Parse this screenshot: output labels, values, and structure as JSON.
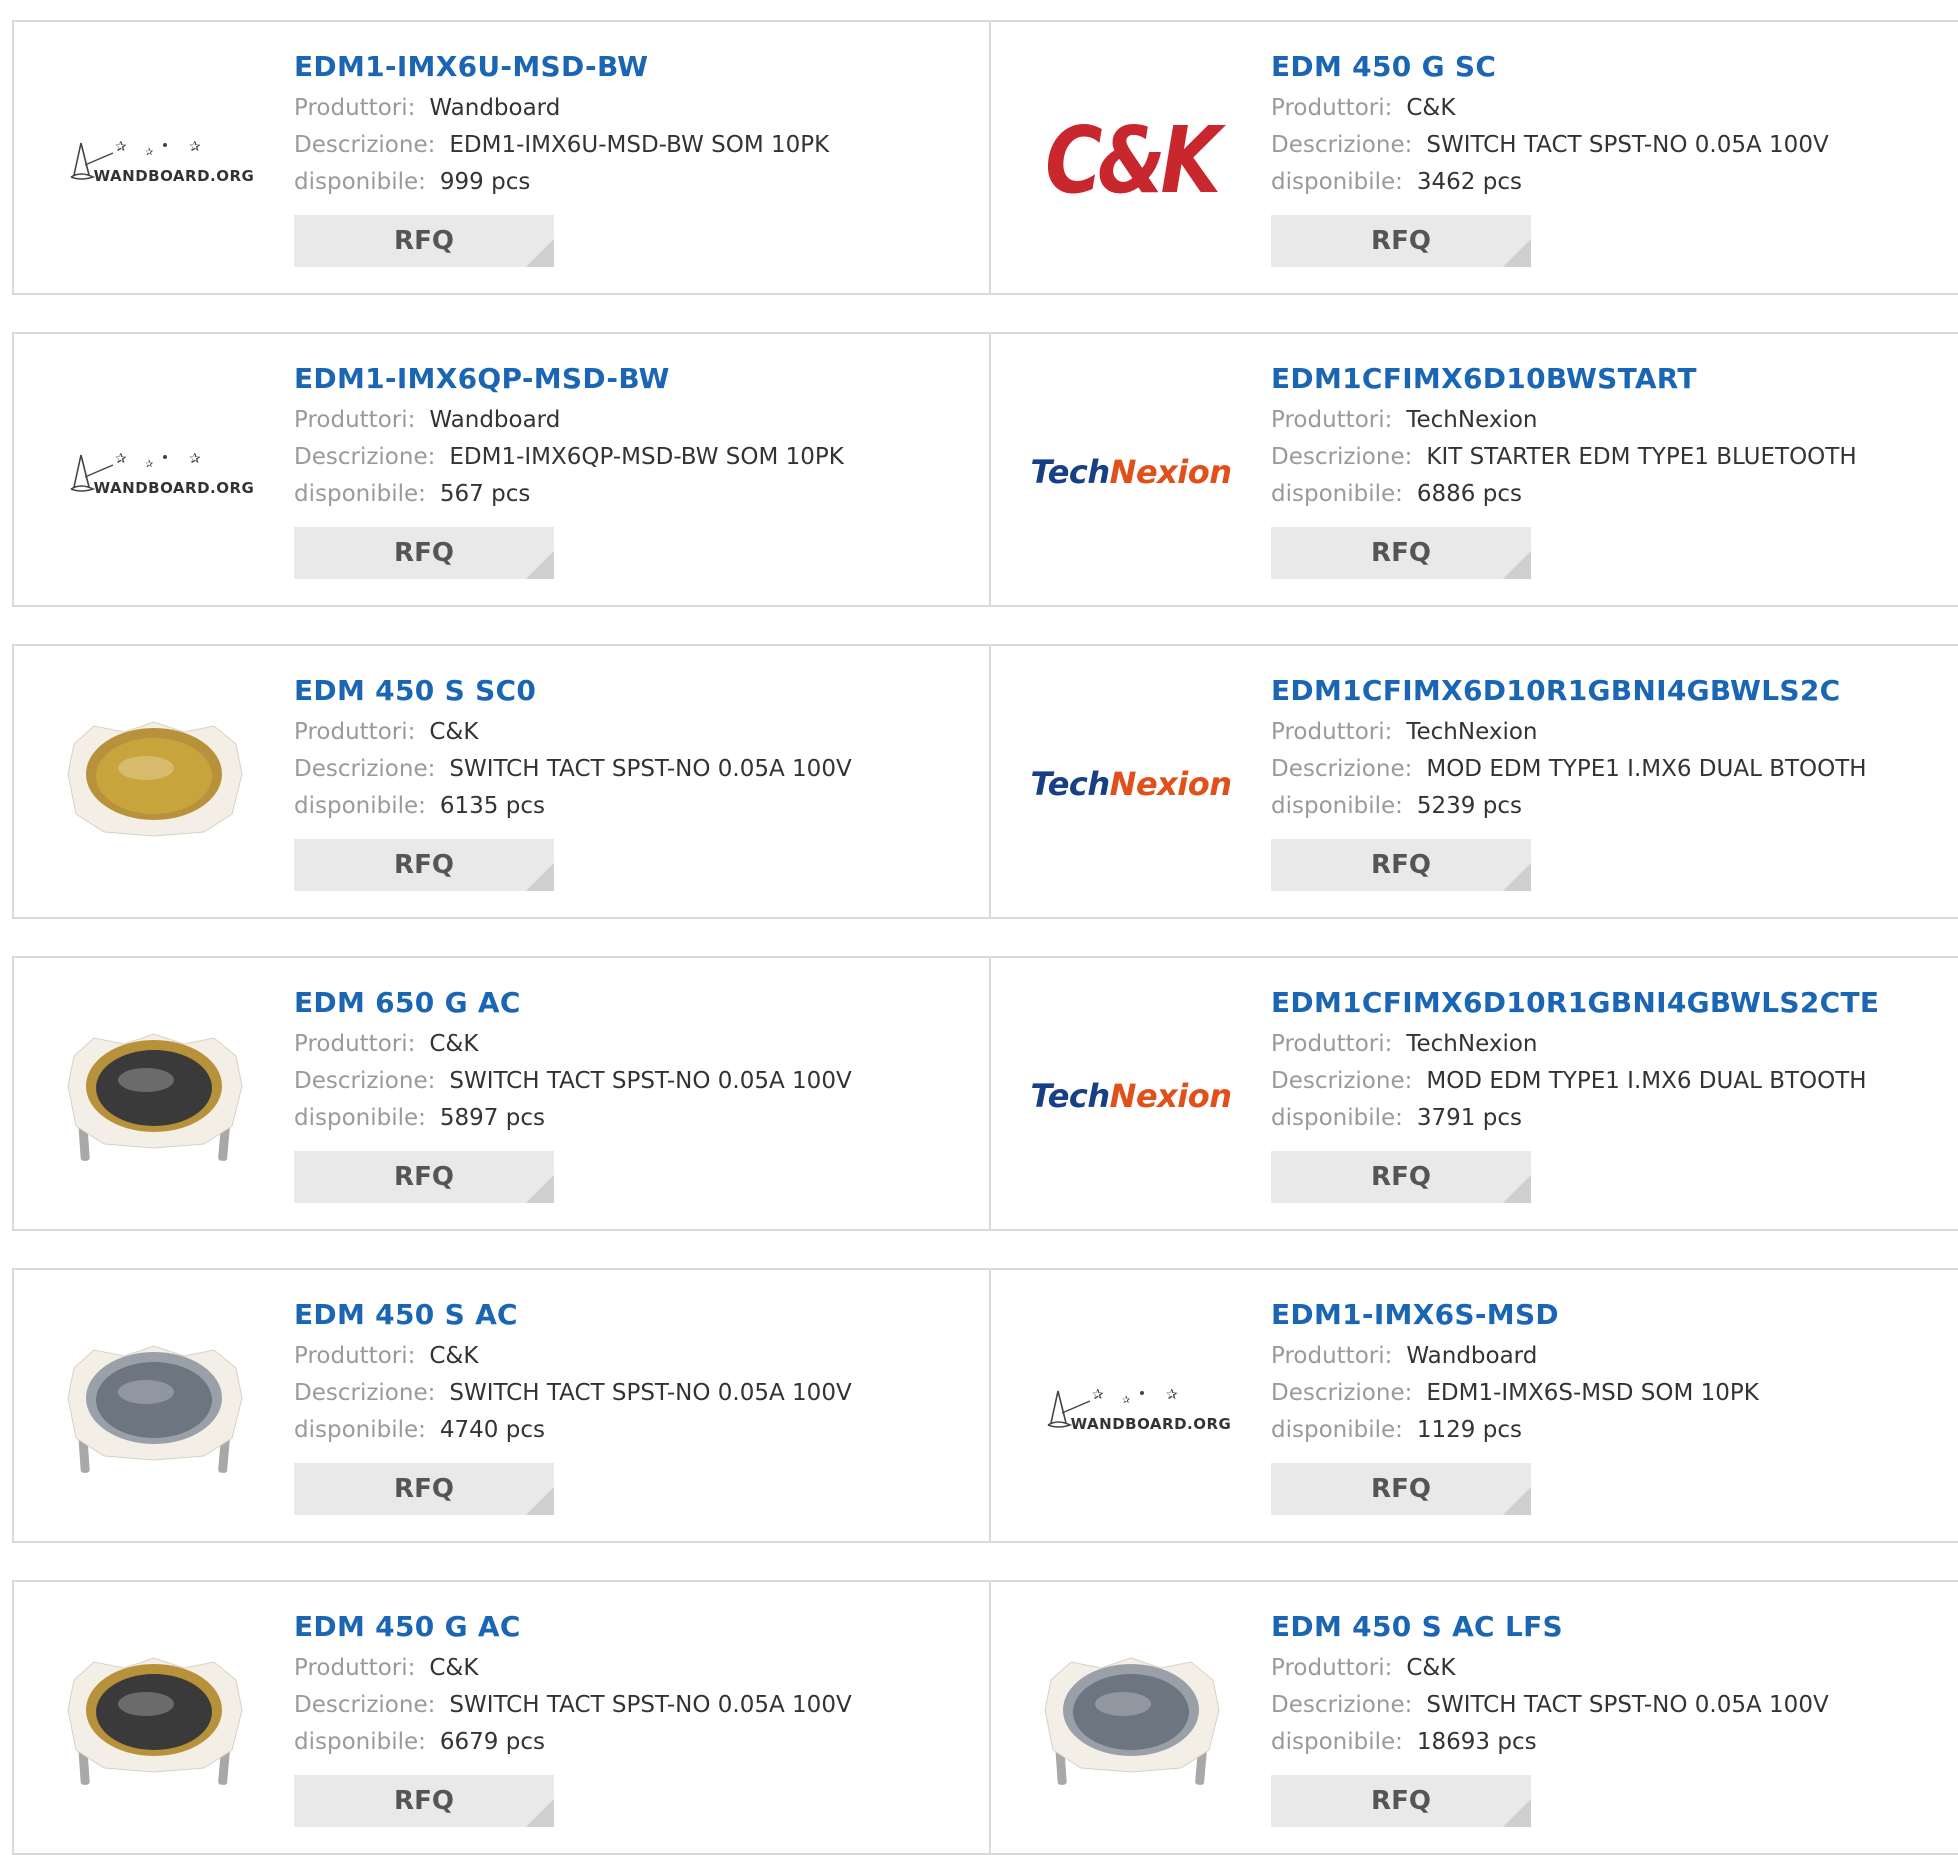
{
  "labels": {
    "producer": "Produttori:",
    "description": "Descrizione:",
    "available": "disponibile:",
    "rfq": "RFQ"
  },
  "colors": {
    "link": "#1a66b4",
    "ck_red": "#c8272d",
    "technexion_blue": "#173f86",
    "technexion_orange": "#e1501b"
  },
  "rows": [
    [
      {
        "part": "EDM1-IMX6U-MSD-BW",
        "producer": "Wandboard",
        "description": "EDM1-IMX6U-MSD-BW SOM 10PK",
        "available": "999 pcs",
        "image": "wandboard-logo"
      },
      {
        "part": "EDM 450 G SC",
        "producer": "C&K",
        "description": "SWITCH TACT SPST-NO 0.05A 100V",
        "available": "3462 pcs",
        "image": "ck-logo"
      }
    ],
    [
      {
        "part": "EDM1-IMX6QP-MSD-BW",
        "producer": "Wandboard",
        "description": "EDM1-IMX6QP-MSD-BW SOM 10PK",
        "available": "567 pcs",
        "image": "wandboard-logo"
      },
      {
        "part": "EDM1CFIMX6D10BWSTART",
        "producer": "TechNexion",
        "description": "KIT STARTER EDM TYPE1 BLUETOOTH",
        "available": "6886 pcs",
        "image": "technexion-logo"
      }
    ],
    [
      {
        "part": "EDM 450 S SC0",
        "producer": "C&K",
        "description": "SWITCH TACT SPST-NO 0.05A 100V",
        "available": "6135 pcs",
        "image": "gold-switch-photo"
      },
      {
        "part": "EDM1CFIMX6D10R1GBNI4GBWLS2C",
        "producer": "TechNexion",
        "description": "MOD EDM TYPE1 I.MX6 DUAL BTOOTH",
        "available": "5239 pcs",
        "image": "technexion-logo"
      }
    ],
    [
      {
        "part": "EDM 650 G AC",
        "producer": "C&K",
        "description": "SWITCH TACT SPST-NO 0.05A 100V",
        "available": "5897 pcs",
        "image": "gold-pin-switch-photo"
      },
      {
        "part": "EDM1CFIMX6D10R1GBNI4GBWLS2CTE",
        "producer": "TechNexion",
        "description": "MOD EDM TYPE1 I.MX6 DUAL BTOOTH",
        "available": "3791 pcs",
        "image": "technexion-logo"
      }
    ],
    [
      {
        "part": "EDM 450 S AC",
        "producer": "C&K",
        "description": "SWITCH TACT SPST-NO 0.05A 100V",
        "available": "4740 pcs",
        "image": "silver-pin-switch-photo"
      },
      {
        "part": "EDM1-IMX6S-MSD",
        "producer": "Wandboard",
        "description": "EDM1-IMX6S-MSD SOM 10PK",
        "available": "1129 pcs",
        "image": "wandboard-logo"
      }
    ],
    [
      {
        "part": "EDM 450 G AC",
        "producer": "C&K",
        "description": "SWITCH TACT SPST-NO 0.05A 100V",
        "available": "6679 pcs",
        "image": "gold-pin-switch-photo"
      },
      {
        "part": "EDM 450 S AC LFS",
        "producer": "C&K",
        "description": "SWITCH TACT SPST-NO 0.05A 100V",
        "available": "18693 pcs",
        "image": "silver-pin-switch-photo"
      }
    ]
  ]
}
